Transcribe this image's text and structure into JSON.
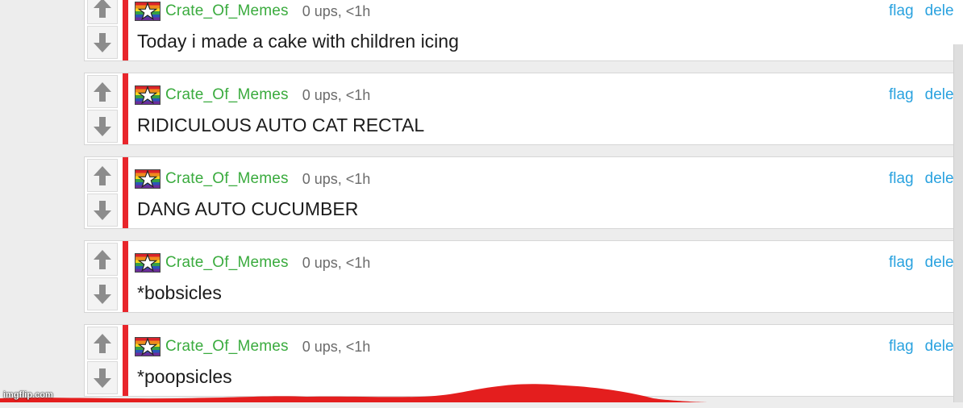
{
  "comments": [
    {
      "username": "Crate_Of_Memes",
      "stats": "0 ups, <1h",
      "text": "Today i made a cake with children icing",
      "flag_label": "flag",
      "delete_label": "dele"
    },
    {
      "username": "Crate_Of_Memes",
      "stats": "0 ups, <1h",
      "text": "RIDICULOUS AUTO CAT RECTAL",
      "flag_label": "flag",
      "delete_label": "dele"
    },
    {
      "username": "Crate_Of_Memes",
      "stats": "0 ups, <1h",
      "text": "DANG AUTO CUCUMBER",
      "flag_label": "flag",
      "delete_label": "dele"
    },
    {
      "username": "Crate_Of_Memes",
      "stats": "0 ups, <1h",
      "text": "*bobsicles",
      "flag_label": "flag",
      "delete_label": "dele"
    },
    {
      "username": "Crate_Of_Memes",
      "stats": "0 ups, <1h",
      "text": "*poopsicles",
      "flag_label": "flag",
      "delete_label": "dele"
    }
  ],
  "icons": {
    "upvote": "up-arrow-icon",
    "downvote": "down-arrow-icon",
    "avatar": "rainbow-star-avatar"
  },
  "colors": {
    "username": "#3aab3e",
    "action_link": "#2aa2df",
    "comment_bar": "#e8252b",
    "scribble": "#e41e1e"
  },
  "watermark": "imgflip.com"
}
